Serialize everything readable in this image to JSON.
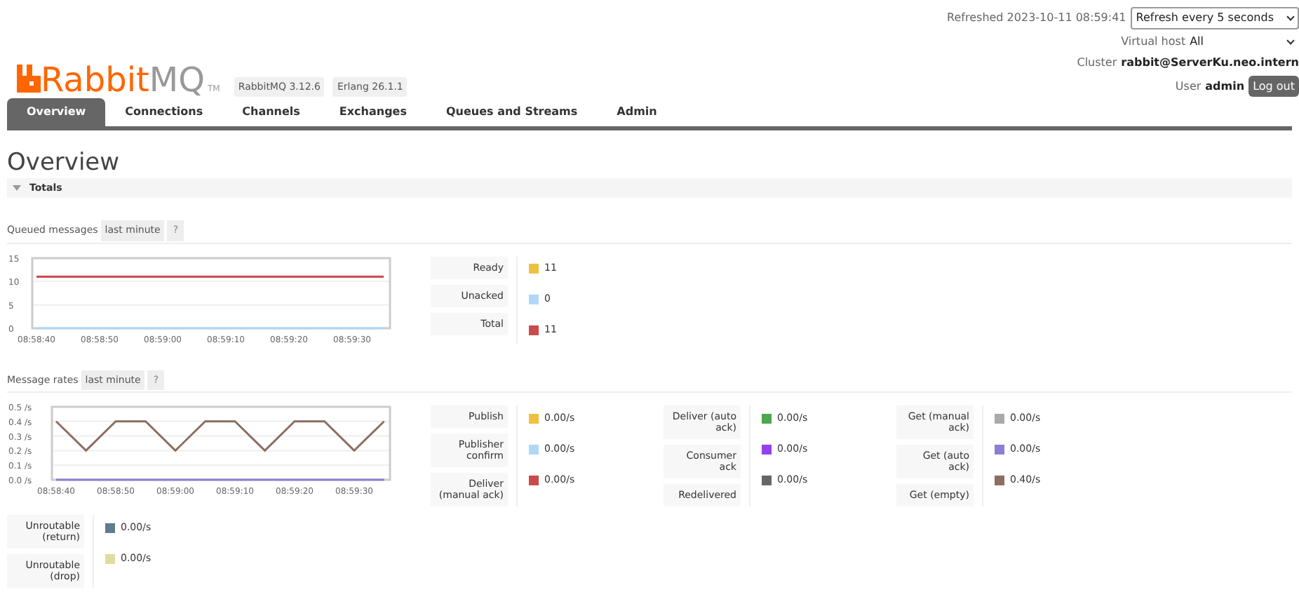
{
  "header": {
    "logo_main": "Rabbit",
    "logo_suffix": "MQ",
    "trademark": "TM",
    "versions": [
      "RabbitMQ 3.12.6",
      "Erlang 26.1.1"
    ],
    "refreshed": "Refreshed 2023-10-11 08:59:41",
    "refresh_select": "Refresh every 5 seconds",
    "vhost_label": "Virtual host",
    "vhost_select": "All",
    "cluster_label": "Cluster",
    "cluster": "rabbit@ServerKu.neo.intern",
    "user_label": "User",
    "user": "admin",
    "logout": "Log out"
  },
  "tabs": [
    {
      "label": "Overview",
      "selected": true
    },
    {
      "label": "Connections",
      "selected": false
    },
    {
      "label": "Channels",
      "selected": false
    },
    {
      "label": "Exchanges",
      "selected": false
    },
    {
      "label": "Queues and Streams",
      "selected": false
    },
    {
      "label": "Admin",
      "selected": false
    }
  ],
  "page_title": "Overview",
  "section": {
    "title": "Totals",
    "expanded": true
  },
  "queued": {
    "label": "Queued messages",
    "range": "last minute",
    "help": "?",
    "chart_data": {
      "type": "line",
      "categories": [
        "08:58:40",
        null,
        "08:58:50",
        null,
        "08:59:00",
        null,
        "08:59:10",
        null,
        "08:59:20",
        null,
        "08:59:30",
        null
      ],
      "grid": true,
      "ylim": [
        0,
        15
      ],
      "yticks": [
        0,
        5,
        10,
        15
      ],
      "series": [
        {
          "color": "#afd8f8",
          "values": [
            0,
            0,
            0,
            0,
            0,
            0,
            0,
            0,
            0,
            0,
            0,
            0
          ]
        },
        {
          "color": "#cb4b4b",
          "values": [
            11,
            11,
            11,
            11,
            11,
            11,
            11,
            11,
            11,
            11,
            11,
            11
          ]
        }
      ]
    },
    "legend": [
      [
        {
          "label": "Ready",
          "color": "#edc240",
          "value": "11"
        },
        {
          "label": "Unacked",
          "color": "#afd8f8",
          "value": "0"
        },
        {
          "label": "Total",
          "color": "#cb4b4b",
          "value": "11"
        }
      ]
    ]
  },
  "rates": {
    "label": "Message rates",
    "range": "last minute",
    "help": "?",
    "chart_data": {
      "type": "line",
      "categories": [
        "08:58:40",
        null,
        "08:58:50",
        null,
        "08:59:00",
        null,
        "08:59:10",
        null,
        "08:59:20",
        null,
        "08:59:30",
        null
      ],
      "grid": true,
      "ylim": [
        0,
        0.5
      ],
      "yticks": [
        {
          "value": 0,
          "label": "0.0 /s"
        },
        {
          "value": 0.1,
          "label": "0.1 /s"
        },
        {
          "value": 0.2,
          "label": "0.2 /s"
        },
        {
          "value": 0.3,
          "label": "0.3 /s"
        },
        {
          "value": 0.4,
          "label": "0.4 /s"
        },
        {
          "value": 0.5,
          "label": "0.5 /s"
        }
      ],
      "series": [
        {
          "color": "#8a7fd4",
          "values": [
            0,
            0,
            0,
            0,
            0,
            0,
            0,
            0,
            0,
            0,
            0,
            0
          ]
        },
        {
          "color": "#8d6e63",
          "values": [
            0.4,
            0.2,
            0.4,
            0.4,
            0.2,
            0.4,
            0.4,
            0.2,
            0.4,
            0.4,
            0.2,
            0.4
          ]
        }
      ]
    },
    "legend": [
      [
        {
          "label": "Publish",
          "color": "#edc240",
          "value": "0.00/s"
        },
        {
          "label": "Publisher confirm",
          "color": "#afd8f8",
          "value": "0.00/s"
        },
        {
          "label": "Deliver (manual ack)",
          "color": "#cb4b4b",
          "value": "0.00/s"
        }
      ],
      [
        {
          "label": "Deliver (auto ack)",
          "color": "#4da74d",
          "value": "0.00/s"
        },
        {
          "label": "Consumer ack",
          "color": "#9440ed",
          "value": "0.00/s"
        },
        {
          "label": "Redelivered",
          "color": "#666666",
          "value": "0.00/s"
        }
      ],
      [
        {
          "label": "Get (manual ack)",
          "color": "#aaaaaa",
          "value": "0.00/s"
        },
        {
          "label": "Get (auto ack)",
          "color": "#8a7fd4",
          "value": "0.00/s"
        },
        {
          "label": "Get (empty)",
          "color": "#8d6e63",
          "value": "0.40/s"
        }
      ]
    ]
  },
  "unroutable": [
    {
      "label": "Unroutable (return)",
      "color": "#607d8b",
      "value": "0.00/s"
    },
    {
      "label": "Unroutable (drop)",
      "color": "#e0dca0",
      "value": "0.00/s"
    }
  ]
}
